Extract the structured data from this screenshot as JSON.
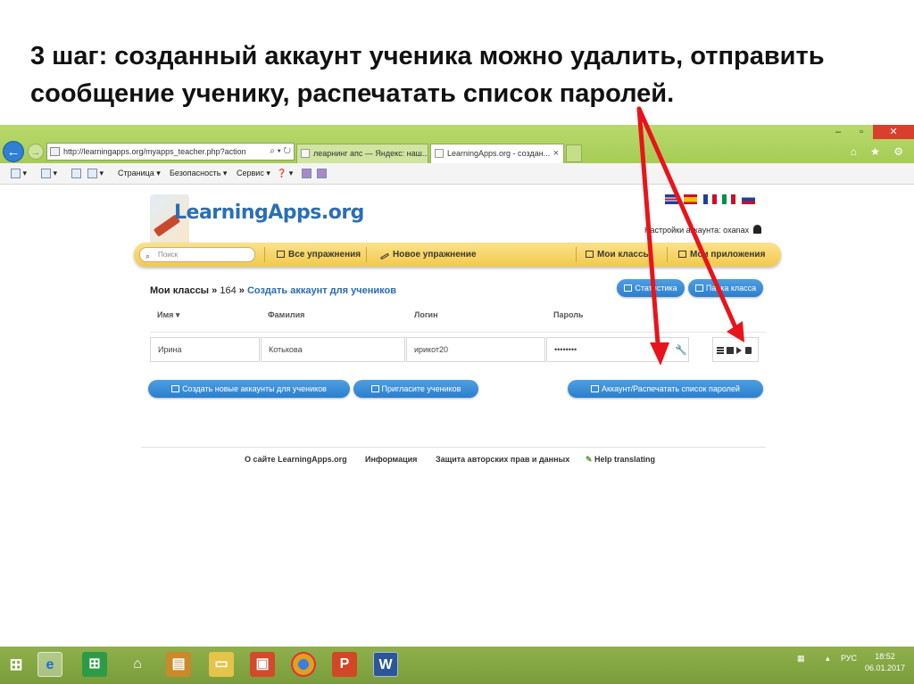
{
  "slide": {
    "title": "3 шаг: созданный аккаунт ученика можно удалить, отправить сообщение ученику, распечатать список паролей."
  },
  "browser": {
    "window_controls": {
      "minimize": "‒",
      "maximize": "▫",
      "close": "✕"
    },
    "back_icon": "←",
    "forward_icon": "→",
    "address": "http://learningapps.org/myapps_teacher.php?action",
    "address_tools": "⌕ ▾ ↻",
    "tabs": [
      {
        "label": "леарнинг апс — Яндекс: наш..."
      },
      {
        "label": "LearningApps.org - создан...",
        "close": "×"
      }
    ],
    "right_icons": "⌂ ★ ⚙",
    "command_bar": {
      "page": "Страница ▾",
      "safety": "Безопасность ▾",
      "service": "Сервис ▾",
      "help": "❓ ▾"
    }
  },
  "site": {
    "logo": "LearningApps.org",
    "flags_colors": [
      "#1f3f9c",
      "#c8102e",
      "#f2c100",
      "#ffffff",
      "#009246",
      "#ffffff"
    ],
    "account_settings": "Настройки аккаунта: oxanax",
    "search": {
      "placeholder": "Поиск",
      "icon": "⌕"
    },
    "menu": {
      "all_exercises": "Все упражнения",
      "new_exercise": "Новое упражнение",
      "my_classes": "Мои классы",
      "my_apps": "Мои приложения"
    },
    "breadcrumb": {
      "root": "Мои классы",
      "sep1": "»",
      "class_id": "164",
      "sep2": "»",
      "current": "Создать аккаунт для учеников"
    },
    "buttons": {
      "statistics": "Статистика",
      "class_folder": "Папка класса",
      "create_accounts": "Создать новые аккаунты для учеников",
      "invite_students": "Пригласите учеников",
      "print_passwords": "Аккаунт/Распечатать список паролей"
    },
    "table": {
      "columns": [
        "Имя ▾",
        "Фамилия",
        "Логин",
        "Пароль"
      ],
      "rows": [
        {
          "first_name": "Ирина",
          "last_name": "Котькова",
          "login": "ирикот20",
          "password": "••••••••"
        }
      ],
      "wrench_icon": "🔧"
    },
    "footer": {
      "about": "О сайте LearningApps.org",
      "info": "Информация",
      "privacy": "Защита авторских прав и данных",
      "help_translating": "Help translating"
    }
  },
  "taskbar": {
    "language": "РУС",
    "time": "18:52",
    "date": "06.01.2017"
  }
}
